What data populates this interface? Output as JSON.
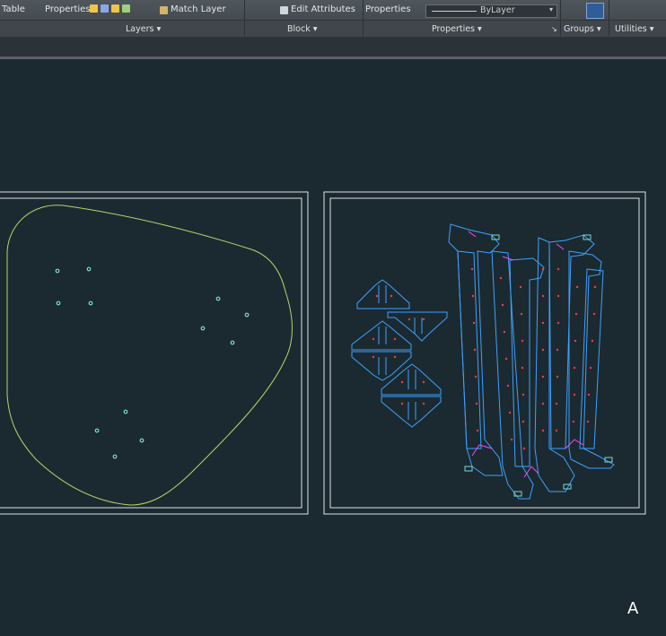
{
  "ribbon": {
    "items": {
      "table": "Table",
      "properties": "Properties",
      "match_layer": "Match Layer",
      "edit_attributes": "Edit Attributes",
      "properties_right": "Properties",
      "bylayer": "ByLayer"
    },
    "panels": {
      "layers": "Layers ▾",
      "block": "Block ▾",
      "properties": "Properties ▾",
      "groups": "Groups ▾",
      "utilities": "Utilities ▾"
    }
  },
  "canvas": {
    "corner_label": "A",
    "background_color": "#1b2a30",
    "frame_color": "#dde3e6",
    "outline_color": "#b7d36a",
    "hole_color": "#7ad9d3",
    "part_color": "#3fa0ff",
    "marker_color": "#ff3b3b",
    "accent_color": "#ff40ff"
  }
}
